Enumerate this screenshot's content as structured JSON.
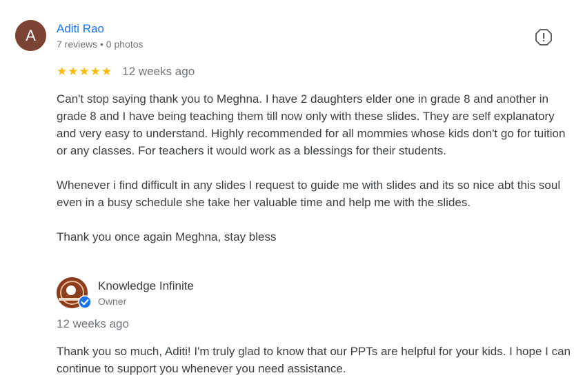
{
  "review": {
    "author": {
      "initial": "A",
      "name": "Aditi Rao",
      "meta": "7 reviews • 0 photos"
    },
    "report_icon": "report-flag-icon",
    "rating": {
      "stars": [
        "★",
        "★",
        "★",
        "★",
        "★"
      ],
      "value": 5,
      "time": "12 weeks ago"
    },
    "paragraphs": [
      "Can't stop saying thank you to Meghna. I have 2 daughters elder one in grade 8 and another in grade 8 and I have being teaching them till now only with these slides. They are self explanatory and very easy to understand. Highly recommended for all mommies whose kids don't go for tuition or any classes. For teachers it would work as a blessings for their students.",
      "Whenever i find difficult in any slides I request to guide me with slides and its so nice abt this soul even in a busy schedule she take her valuable time and help me with the slides.",
      "Thank you once again Meghna, stay bless"
    ]
  },
  "owner_reply": {
    "name": "Knowledge Infinite",
    "role": "Owner",
    "verified_icon": "verified-check-icon",
    "time": "12 weeks ago",
    "text": "Thank you so much, Aditi! I'm truly glad to know that our PPTs are helpful for your kids. I hope I can continue to support you whenever you need assistance."
  },
  "colors": {
    "author_link": "#1a73e8",
    "star": "#fbbc04",
    "avatar_bg": "#7a4332",
    "verified": "#1a73e8",
    "secondary_text": "#70757a",
    "body_text": "#3c4043"
  }
}
